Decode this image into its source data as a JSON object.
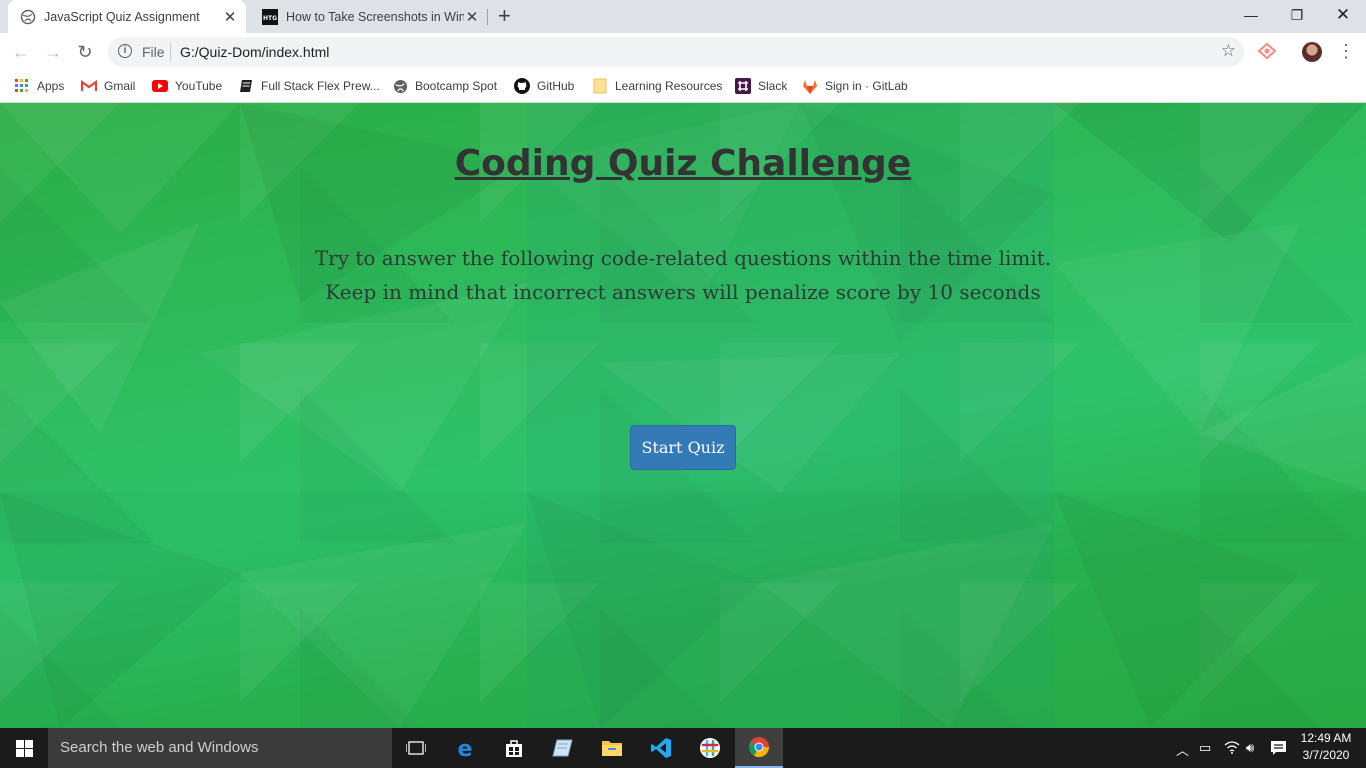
{
  "browser": {
    "tabs": [
      {
        "title": "JavaScript Quiz Assignment",
        "active": true
      },
      {
        "title": "How to Take Screenshots in Windo",
        "active": false
      }
    ],
    "address": {
      "scheme_label": "File",
      "url": "G:/Quiz-Dom/index.html"
    },
    "bookmarks": [
      {
        "label": "Apps",
        "icon": "apps-grid-icon"
      },
      {
        "label": "Gmail",
        "icon": "gmail-icon"
      },
      {
        "label": "YouTube",
        "icon": "youtube-icon"
      },
      {
        "label": "Full Stack Flex Prew...",
        "icon": "book-icon"
      },
      {
        "label": "Bootcamp Spot",
        "icon": "globe-icon"
      },
      {
        "label": "GitHub",
        "icon": "github-icon"
      },
      {
        "label": "Learning Resources",
        "icon": "folder-icon"
      },
      {
        "label": "Slack",
        "icon": "slack-icon"
      },
      {
        "label": "Sign in · GitLab",
        "icon": "gitlab-icon"
      }
    ]
  },
  "page": {
    "title": "Coding Quiz Challenge",
    "description_line1": "Try to answer the following code-related questions within the time limit.",
    "description_line2": "Keep in mind that incorrect answers will penalize score by 10 seconds",
    "start_button": "Start Quiz"
  },
  "taskbar": {
    "search_placeholder": "Search the web and Windows",
    "time": "12:49 AM",
    "date": "3/7/2020"
  },
  "colors": {
    "page_green": "#2eb85c",
    "button_blue": "#337ab7",
    "title_text": "#333333"
  }
}
